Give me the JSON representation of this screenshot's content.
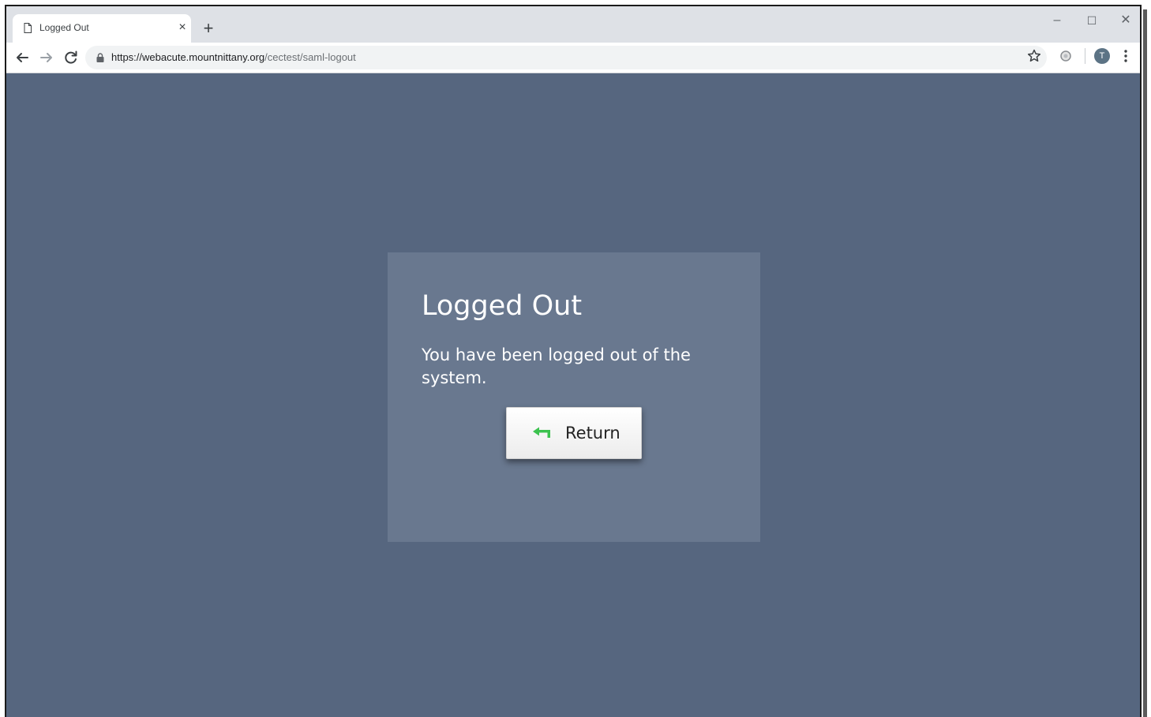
{
  "browser": {
    "tab": {
      "title": "Logged Out",
      "close_glyph": "×",
      "icon": "page-icon"
    },
    "new_tab_glyph": "+",
    "window_controls": {
      "minimize": "–",
      "maximize": "☐",
      "close": "✕"
    },
    "address_bar": {
      "url_host": "https://webacute.mountnittany.org",
      "url_path": "/cectest/saml-logout"
    },
    "profile_initial": "T"
  },
  "logout_card": {
    "title": "Logged Out",
    "message": "You have been logged out of the system.",
    "return_label": "Return",
    "return_icon": "return-arrow-icon"
  },
  "colors": {
    "page_background": "#56667f",
    "card_background": "#69788f",
    "return_icon_color": "#3cc24f"
  }
}
